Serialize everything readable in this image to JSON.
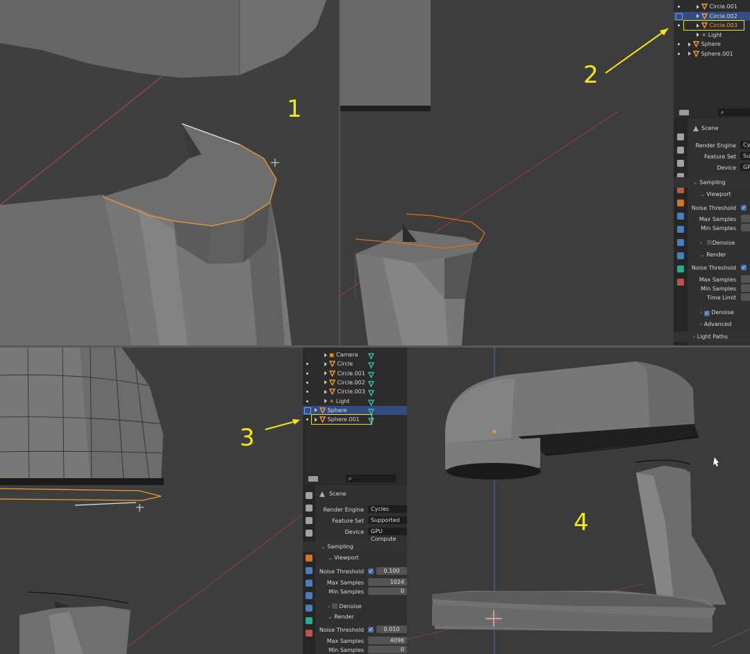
{
  "annotations": {
    "q1": "1",
    "q2": "2",
    "q3": "3",
    "q4": "4"
  },
  "outliner_q2": {
    "items": [
      {
        "label": "Circle.001",
        "selected": false,
        "highlight": false,
        "dot": true
      },
      {
        "label": "Circle.002",
        "selected": true,
        "highlight": false,
        "dot": false
      },
      {
        "label": "Circle.003",
        "selected": false,
        "highlight": true,
        "dot": true
      },
      {
        "label": "Light",
        "selected": false,
        "highlight": false,
        "dot": false
      },
      {
        "label": "Sphere",
        "selected": false,
        "highlight": false,
        "dot": true
      },
      {
        "label": "Sphere.001",
        "selected": false,
        "highlight": false,
        "dot": true
      }
    ]
  },
  "properties_q2": {
    "scene_label": "Scene",
    "render_engine_label": "Render Engine",
    "render_engine_value": "Cy",
    "feature_set_label": "Feature Set",
    "feature_set_value": "Su",
    "device_label": "Device",
    "device_value": "GP",
    "sampling": "Sampling",
    "viewport": "Viewport",
    "noise_threshold": "Noise Threshold",
    "max_samples": "Max Samples",
    "min_samples": "Min Samples",
    "denoise": "Denoise",
    "render": "Render",
    "noise_threshold_r": "Noise Threshold",
    "max_samples_r": "Max Samples",
    "min_samples_r": "Min Samples",
    "time_limit": "Time Limit",
    "denoise_r": "Denoise",
    "advanced": "Advanced",
    "light_paths": "Light Paths"
  },
  "outliner_q3": {
    "items": [
      {
        "label": "Camera",
        "dot": false
      },
      {
        "label": "Circle",
        "dot": true
      },
      {
        "label": "Circle.001",
        "dot": true
      },
      {
        "label": "Circle.002",
        "dot": true
      },
      {
        "label": "Circle.003",
        "dot": true
      },
      {
        "label": "Light",
        "dot": true
      },
      {
        "label": "Sphere",
        "dot": false,
        "selected": true
      },
      {
        "label": "Sphere.001",
        "dot": true,
        "highlight": true
      }
    ]
  },
  "properties_q3": {
    "scene_label": "Scene",
    "render_engine_label": "Render Engine",
    "render_engine_value": "Cycles",
    "feature_set_label": "Feature Set",
    "feature_set_value": "Supported",
    "device_label": "Device",
    "device_value": "GPU Compute",
    "sampling": "Sampling",
    "viewport": "Viewport",
    "noise_threshold": "Noise Threshold",
    "noise_threshold_value": "0.100",
    "max_samples": "Max Samples",
    "max_samples_value": "1024",
    "min_samples": "Min Samples",
    "min_samples_value": "0",
    "denoise": "Denoise",
    "render": "Render",
    "noise_threshold_r": "Noise Threshold",
    "noise_threshold_r_value": "0.010",
    "max_samples_r": "Max Samples",
    "max_samples_r_value": "4096",
    "min_samples_r": "Min Samples",
    "min_samples_r_value": "0"
  },
  "colors": {
    "annotation": "#f5e61a",
    "selection": "#f09a2c",
    "outliner_select": "#334d80",
    "checkbox": "#4772b3"
  }
}
